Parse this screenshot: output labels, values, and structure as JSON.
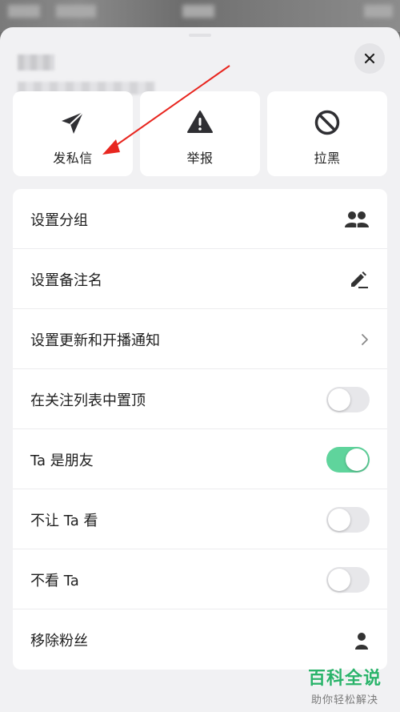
{
  "header": {
    "user_name": "■■■",
    "user_subtitle": "■■■■■■■■■■■"
  },
  "actions": [
    {
      "label": "发私信",
      "icon": "paper-plane-icon"
    },
    {
      "label": "举报",
      "icon": "warning-icon"
    },
    {
      "label": "拉黑",
      "icon": "block-icon"
    }
  ],
  "settings": [
    {
      "label": "设置分组",
      "control": "group-icon"
    },
    {
      "label": "设置备注名",
      "control": "pencil-icon"
    },
    {
      "label": "设置更新和开播通知",
      "control": "chevron-right-icon"
    },
    {
      "label": "在关注列表中置顶",
      "control": "toggle",
      "on": false
    },
    {
      "label": "Ta 是朋友",
      "control": "toggle",
      "on": true
    },
    {
      "label": "不让 Ta 看",
      "control": "toggle",
      "on": false
    },
    {
      "label": "不看 Ta",
      "control": "toggle",
      "on": false
    },
    {
      "label": "移除粉丝",
      "control": "person-remove-icon"
    }
  ],
  "colors": {
    "toggle_on": "#5fd49c",
    "annotation_arrow": "#e8261f",
    "watermark": "#2ab36a"
  },
  "watermark": {
    "title": "百科全说",
    "subtitle": "助你轻松解决"
  }
}
